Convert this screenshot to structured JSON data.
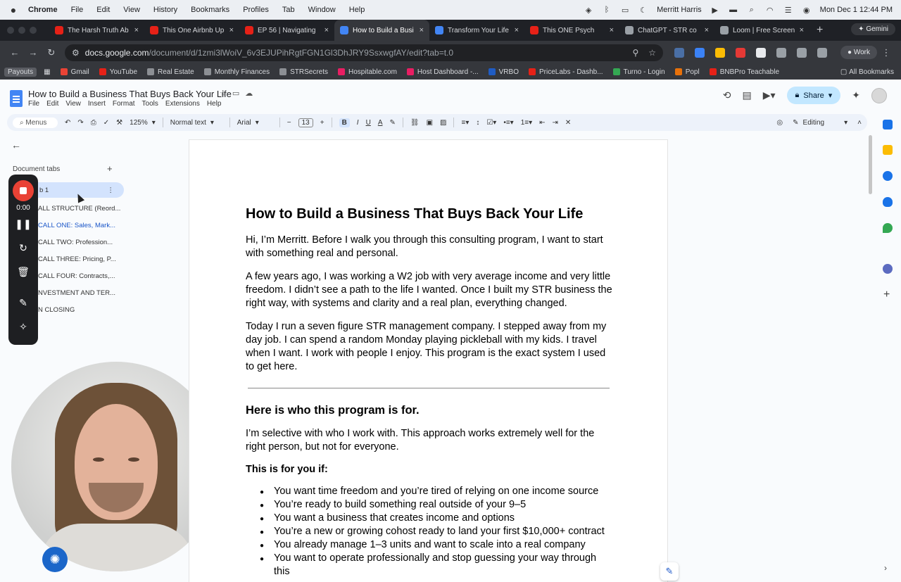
{
  "macbar": {
    "apple": "",
    "menus": [
      "Chrome",
      "File",
      "Edit",
      "View",
      "History",
      "Bookmarks",
      "Profiles",
      "Tab",
      "Window",
      "Help"
    ],
    "user": "Merritt Harris",
    "datetime": "Mon Dec 1  12:44 PM"
  },
  "tabs": [
    {
      "title": "The Harsh Truth Ab",
      "color": "#e62117"
    },
    {
      "title": "This One Airbnb Up",
      "color": "#e62117"
    },
    {
      "title": "EP 56 | Navigating",
      "color": "#e62117"
    },
    {
      "title": "How to Build a Busi",
      "color": "#4285f4",
      "active": true
    },
    {
      "title": "Transform Your Life",
      "color": "#4285f4"
    },
    {
      "title": "This ONE Psych",
      "color": "#e62117"
    },
    {
      "title": "ChatGPT - STR co",
      "color": "#9aa0a6"
    },
    {
      "title": "Loom | Free Screen",
      "color": "#9aa0a6"
    }
  ],
  "gemini_label": "Gemini",
  "address": {
    "host": "docs.google.com",
    "path": "/document/d/1zmi3lWoiV_6v3EJUPihRgtFGN1Gl3DhJRY9SsxwgfAY/edit?tab=t.0",
    "profile_label": "Work"
  },
  "bookmarks": {
    "payouts": "Payouts",
    "items": [
      {
        "label": "Gmail",
        "color": "#ea4335"
      },
      {
        "label": "YouTube",
        "color": "#e62117"
      },
      {
        "label": "Real Estate",
        "color": "#8c8f94"
      },
      {
        "label": "Monthly Finances",
        "color": "#8c8f94"
      },
      {
        "label": "STRSecrets",
        "color": "#8c8f94"
      },
      {
        "label": "Hospitable.com",
        "color": "#e91e63"
      },
      {
        "label": "Host Dashboard -...",
        "color": "#e91e63"
      },
      {
        "label": "VRBO",
        "color": "#1f5cc4"
      },
      {
        "label": "PriceLabs - Dashb...",
        "color": "#e62117"
      },
      {
        "label": "Turno - Login",
        "color": "#34a853"
      },
      {
        "label": "Popl",
        "color": "#e8710a"
      },
      {
        "label": "BNBPro Teachable",
        "color": "#e62117"
      }
    ],
    "all": "All Bookmarks"
  },
  "doc": {
    "title": "How to Build a Business That Buys Back Your Life",
    "menus": [
      "File",
      "Edit",
      "View",
      "Insert",
      "Format",
      "Tools",
      "Extensions",
      "Help"
    ],
    "share_label": "Share"
  },
  "toolbar": {
    "search": "Menus",
    "zoom": "125%",
    "style": "Normal text",
    "font": "Arial",
    "font_size": "13",
    "mode": "Editing"
  },
  "left_panel": {
    "heading": "Document tabs",
    "items": [
      "b 1",
      "ALL STRUCTURE (Reord...",
      "CALL ONE: Sales, Mark...",
      "CALL TWO: Profession...",
      "CALL THREE: Pricing, P...",
      "CALL FOUR: Contracts,...",
      "NVESTMENT AND TER...",
      "N CLOSING"
    ]
  },
  "recorder": {
    "time": "0:00"
  },
  "content": {
    "h1": "How to Build a Business That Buys Back Your Life",
    "p1": "Hi, I’m Merritt. Before I walk you through this consulting program, I want to start with something real and personal.",
    "p2": "A few years ago, I was working a W2 job with very average income and very little freedom. I didn’t see a path to the life I wanted. Once I built my STR business the right way, with systems and clarity and a real plan, everything changed.",
    "p3": "Today I run a seven figure STR management company. I stepped away from my day job. I can spend a random Monday playing pickleball with my kids. I travel when I want. I work with people I enjoy. This program is the exact system I used to get here.",
    "h2": "Here is who this program is for.",
    "p4": "I’m selective with who I work with. This approach works extremely well for the right person, but not for everyone.",
    "h3": "This is for you if:",
    "bullets": [
      "You want time freedom and you’re tired of relying on one income source",
      "You’re ready to build something real outside of your 9–5",
      "You want a business that creates income and options",
      "You’re a new or growing cohost ready to land your first $10,000+ contract",
      "You already manage 1–3 units and want to scale into a real company",
      "You want to operate professionally and stop guessing your way through this"
    ]
  }
}
